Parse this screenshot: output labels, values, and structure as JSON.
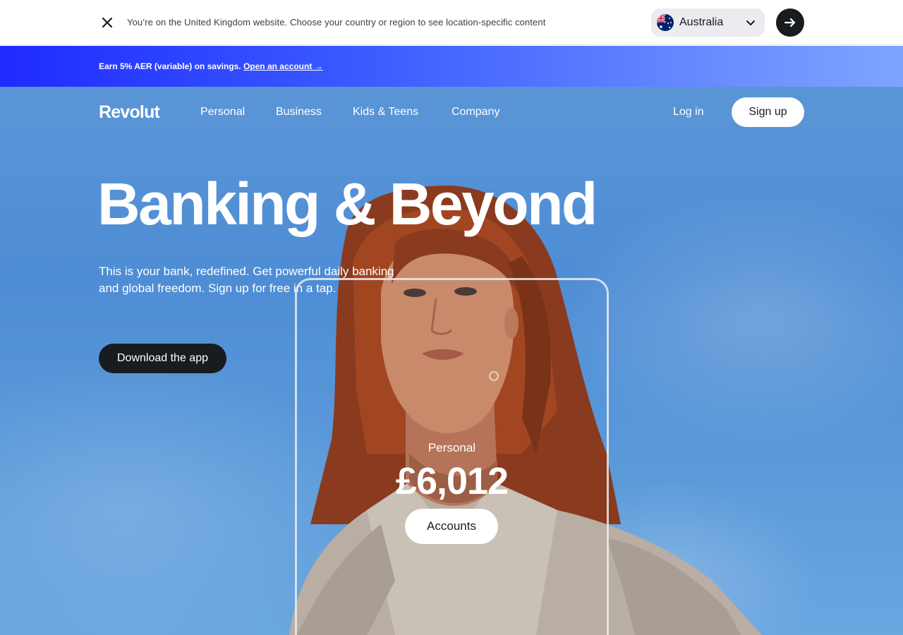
{
  "country_bar": {
    "message": "You’re on the United Kingdom website. Choose your country or region to see location-specific content",
    "close_icon": "close-icon",
    "selected_country": "Australia",
    "flag_icon": "australia-flag-icon",
    "dropdown_icon": "chevron-down-icon",
    "go_icon": "arrow-right-icon"
  },
  "promo": {
    "text": "Earn 5% AER (variable) on savings.",
    "link": "Open an account →"
  },
  "nav": {
    "logo": "Revolut",
    "items": [
      {
        "label": "Personal"
      },
      {
        "label": "Business"
      },
      {
        "label": "Kids & Teens"
      },
      {
        "label": "Company"
      }
    ],
    "login": "Log in",
    "signup": "Sign up"
  },
  "hero": {
    "headline": "Banking & Beyond",
    "subtext": "This is your bank, redefined. Get powerful daily banking and global freedom. Sign up for free in a tap.",
    "cta": "Download the app"
  },
  "phone_card": {
    "label": "Personal",
    "amount": "£6,012",
    "button": "Accounts"
  },
  "colors": {
    "brand_dark": "#191c1f",
    "promo_start": "#1f2bff",
    "promo_end": "#7ea4ff",
    "sky": "#4e8dd5"
  }
}
